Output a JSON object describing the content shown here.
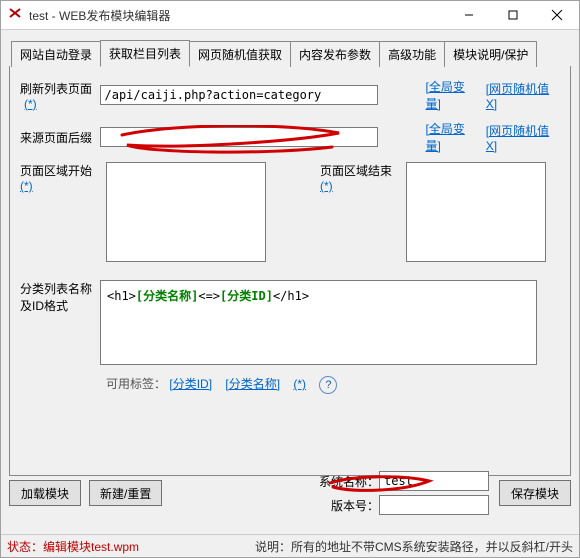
{
  "window": {
    "title": "test - WEB发布模块编辑器"
  },
  "tabs": [
    "网站自动登录",
    "获取栏目列表",
    "网页随机值获取",
    "内容发布参数",
    "高级功能",
    "模块说明/保护"
  ],
  "active_tab_index": 1,
  "refresh": {
    "label": "刷新列表页面",
    "star": "(*)",
    "value": "/api/caiji.php?action=category",
    "link_global": "[全局变量]",
    "link_random": "[网页随机值X]"
  },
  "source": {
    "label": "来源页面后缀",
    "value": "",
    "link_global": "[全局变量]",
    "link_random": "[网页随机值X]"
  },
  "area_start": {
    "label": "页面区域开始",
    "star": "(*)",
    "value": ""
  },
  "area_end": {
    "label": "页面区域结束",
    "star": "(*)",
    "value": ""
  },
  "format": {
    "label": "分类列表名称及ID格式",
    "prefix": "<h1>",
    "name": "[分类名称]",
    "sep": "<=>",
    "id": "[分类ID]",
    "suffix": "</h1>"
  },
  "available_tags": {
    "label": "可用标签：",
    "tag_id": "[分类ID]",
    "tag_name": "[分类名称]",
    "star": "(*)"
  },
  "system": {
    "name_label": "系统名称：",
    "name_value": "test",
    "version_label": "版本号："
  },
  "buttons": {
    "load": "加载模块",
    "new": "新建/重置",
    "save": "保存模块"
  },
  "status": {
    "state_label": "状态：",
    "state_value": "编辑模块test.wpm",
    "hint_label": "说明：",
    "hint_value": "所有的地址不带CMS系统安装路径，并以反斜杠/开头"
  }
}
